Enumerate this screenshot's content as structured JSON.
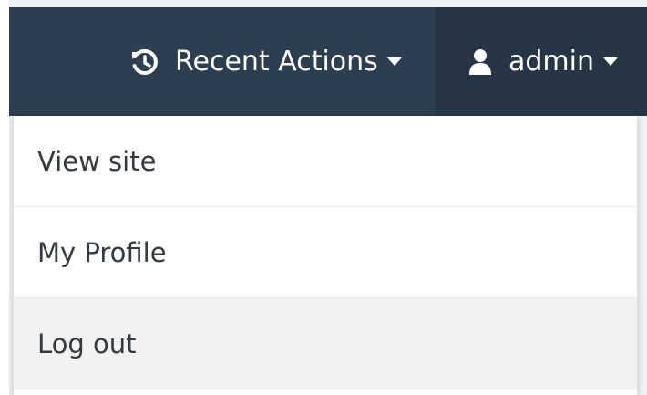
{
  "navbar": {
    "recent_actions": {
      "icon": "history-icon",
      "label": "Recent Actions"
    },
    "user": {
      "icon": "user-icon",
      "label": "admin"
    }
  },
  "dropdown": {
    "items": [
      {
        "label": "View site"
      },
      {
        "label": "My Profile"
      },
      {
        "label": "Log out"
      }
    ]
  },
  "colors": {
    "navbar_bg": "#2c3e50",
    "navbar_active_bg": "#273646",
    "menu_hover_bg": "#f2f2f2",
    "text": "#333a42"
  }
}
